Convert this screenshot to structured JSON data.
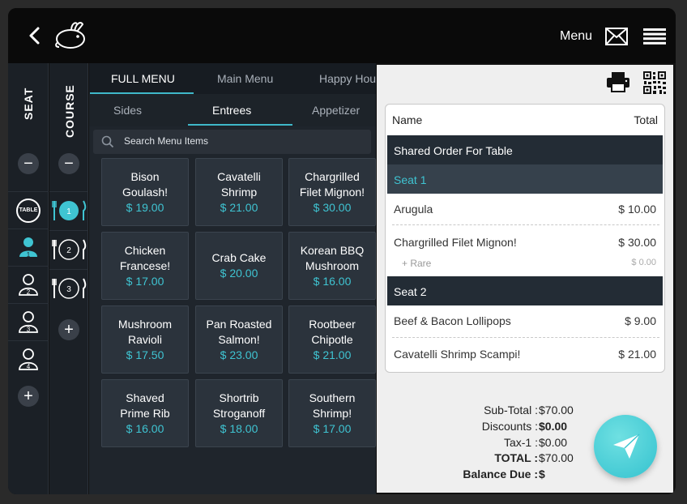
{
  "header": {
    "menu_label": "Menu"
  },
  "sidebar": {
    "seat_label": "SEAT",
    "course_label": "COURSE",
    "table_label": "TABLE",
    "seats": [
      "1",
      "2",
      "3",
      "4"
    ],
    "courses": [
      "1",
      "2",
      "3"
    ]
  },
  "menu": {
    "category_tabs": [
      "FULL MENU",
      "Main Menu",
      "Happy Hou"
    ],
    "sub_tabs": [
      "Sides",
      "Entrees",
      "Appetizer"
    ],
    "search_placeholder": "Search Menu Items",
    "items": [
      {
        "name_line1": "Bison",
        "name_line2": "Goulash!",
        "price": "$ 19.00"
      },
      {
        "name_line1": "Cavatelli",
        "name_line2": "Shrimp",
        "price": "$ 21.00"
      },
      {
        "name_line1": "Chargrilled",
        "name_line2": "Filet Mignon!",
        "price": "$ 30.00"
      },
      {
        "name_line1": "Chicken",
        "name_line2": "Francese!",
        "price": "$ 17.00"
      },
      {
        "name_line1": "Crab Cake",
        "name_line2": "",
        "price": "$ 20.00"
      },
      {
        "name_line1": "Korean BBQ",
        "name_line2": "Mushroom",
        "price": "$ 16.00"
      },
      {
        "name_line1": "Mushroom",
        "name_line2": "Ravioli",
        "price": "$ 17.50"
      },
      {
        "name_line1": "Pan Roasted",
        "name_line2": "Salmon!",
        "price": "$ 23.00"
      },
      {
        "name_line1": "Rootbeer",
        "name_line2": "Chipotle",
        "price": "$ 21.00"
      },
      {
        "name_line1": "Shaved",
        "name_line2": "Prime Rib",
        "price": "$ 16.00"
      },
      {
        "name_line1": "Shortrib",
        "name_line2": "Stroganoff",
        "price": "$ 18.00"
      },
      {
        "name_line1": "Southern",
        "name_line2": "Shrimp!",
        "price": "$ 17.00"
      }
    ]
  },
  "order": {
    "col_name": "Name",
    "col_total": "Total",
    "shared_label": "Shared Order For Table",
    "seat1_label": "Seat 1",
    "seat1_items": [
      {
        "name": "Arugula",
        "price": "$ 10.00"
      },
      {
        "name": "Chargrilled Filet Mignon!",
        "price": "$ 30.00",
        "modifier": "+ Rare",
        "modifier_price": "$ 0.00"
      }
    ],
    "seat2_label": "Seat 2",
    "seat2_items": [
      {
        "name": "Beef & Bacon Lollipops",
        "price": "$ 9.00"
      },
      {
        "name": "Cavatelli Shrimp Scampi!",
        "price": "$ 21.00"
      }
    ]
  },
  "totals": {
    "subtotal_label": "Sub-Total :",
    "subtotal_value": "$70.00",
    "discounts_label": "Discounts :",
    "discounts_value": "$0.00",
    "tax_label": "Tax-1 :",
    "tax_value": "$0.00",
    "total_label": "TOTAL :",
    "total_value": "$70.00",
    "balance_label": "Balance Due :",
    "balance_value": "$"
  },
  "colors": {
    "accent": "#3fc4d2",
    "dark_section": "#232c35",
    "send_button": "#4fd0d8"
  }
}
